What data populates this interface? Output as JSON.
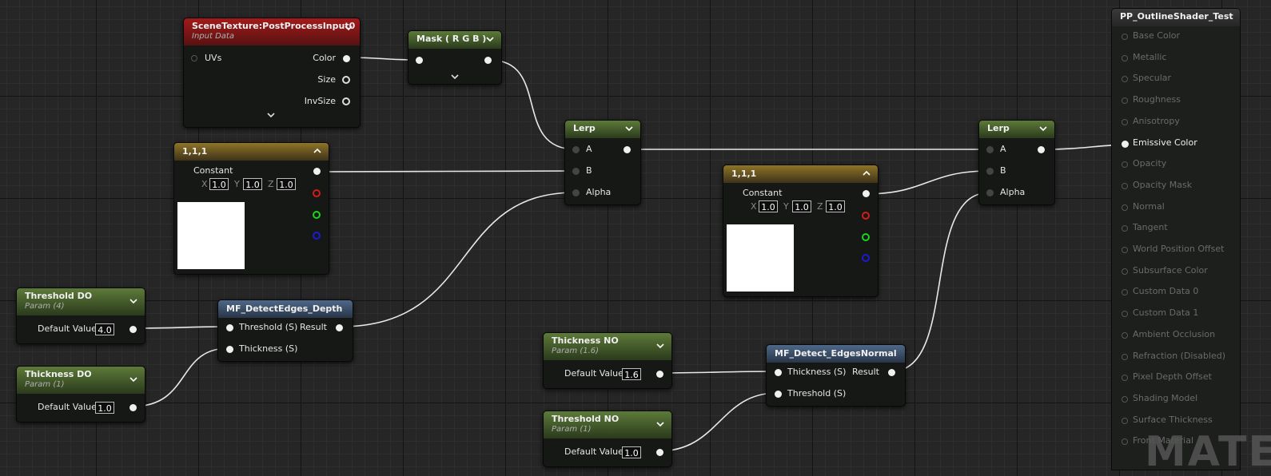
{
  "nodes": {
    "scene_texture": {
      "title": "SceneTexture:PostProcessInput0",
      "subtitle": "Input Data",
      "inputs": [
        "UVs"
      ],
      "outputs": [
        "Color",
        "Size",
        "InvSize"
      ]
    },
    "mask": {
      "title": "Mask ( R G B )"
    },
    "lerp1": {
      "title": "Lerp",
      "inputs": [
        "A",
        "B",
        "Alpha"
      ]
    },
    "lerp2": {
      "title": "Lerp",
      "inputs": [
        "A",
        "B",
        "Alpha"
      ]
    },
    "constant1": {
      "title": "1,1,1",
      "label": "Constant",
      "x_label": "X",
      "y_label": "Y",
      "z_label": "Z",
      "x": "1.0",
      "y": "1.0",
      "z": "1.0",
      "swatch_color": "#ffffff"
    },
    "constant2": {
      "title": "1,1,1",
      "label": "Constant",
      "x_label": "X",
      "y_label": "Y",
      "z_label": "Z",
      "x": "1.0",
      "y": "1.0",
      "z": "1.0",
      "swatch_color": "#ffffff"
    },
    "threshold_do": {
      "title": "Threshold DO",
      "subtitle": "Param (4)",
      "label": "Default Value",
      "value": "4.0"
    },
    "thickness_do": {
      "title": "Thickness DO",
      "subtitle": "Param (1)",
      "label": "Default Value",
      "value": "1.0"
    },
    "detect_depth": {
      "title": "MF_DetectEdges_Depth",
      "inputs": [
        "Threshold (S)",
        "Thickness (S)"
      ],
      "output": "Result"
    },
    "thickness_no": {
      "title": "Thickness NO",
      "subtitle": "Param (1.6)",
      "label": "Default Value",
      "value": "1.6"
    },
    "threshold_no": {
      "title": "Threshold NO",
      "subtitle": "Param (1)",
      "label": "Default Value",
      "value": "1.0"
    },
    "detect_normal": {
      "title": "MF_Detect_EdgesNormal",
      "inputs": [
        "Thickness (S)",
        "Threshold (S)"
      ],
      "output": "Result"
    }
  },
  "output_node": {
    "title": "PP_OutlineShader_Test",
    "pins": [
      "Base Color",
      "Metallic",
      "Specular",
      "Roughness",
      "Anisotropy",
      "Emissive Color",
      "Opacity",
      "Opacity Mask",
      "Normal",
      "Tangent",
      "World Position Offset",
      "Subsurface Color",
      "Custom Data 0",
      "Custom Data 1",
      "Ambient Occlusion",
      "Refraction (Disabled)",
      "Pixel Depth Offset",
      "Shading Model",
      "Surface Thickness",
      "Front Material"
    ],
    "active_pin": "Emissive Color"
  },
  "watermark": "MATE",
  "colors": {
    "graph_bg": "#262626",
    "header_red": "#a31a1a",
    "header_green": "#5d7a39",
    "header_gold": "#8e7426",
    "header_blue": "#4e6887",
    "wire": "#f0f0f0"
  },
  "icons": {
    "collapse": "chevron-down-icon",
    "expand": "chevron-up-icon"
  }
}
